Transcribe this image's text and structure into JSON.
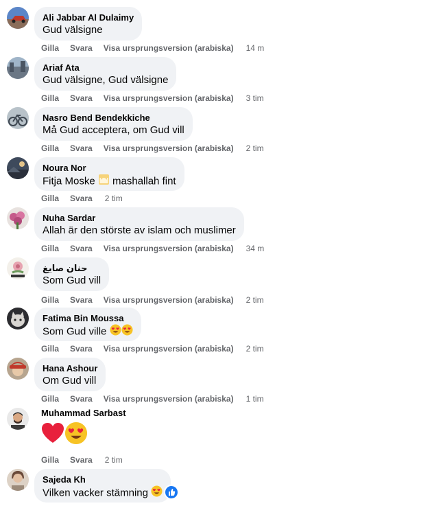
{
  "actions": {
    "like": "Gilla",
    "reply": "Svara",
    "see_original": "Visa ursprungsversion (arabiska)"
  },
  "comments": [
    {
      "author": "Ali Jabbar Al Dulaimy",
      "text": "Gud välsigne",
      "time": "14 m",
      "translated": true,
      "avatar": "red-car-avatar"
    },
    {
      "author": "Ariaf Ata",
      "text": "Gud välsigne, Gud välsigne",
      "time": "3 tim",
      "translated": true,
      "avatar": "city-scene-avatar"
    },
    {
      "author": "Nasro Bend Bendekkiche",
      "text": "Må Gud acceptera, om Gud vill",
      "time": "2 tim",
      "translated": true,
      "avatar": "bicycle-avatar"
    },
    {
      "author": "Noura Nor",
      "text": "Fitja Moske",
      "text_suffix": "mashallah fint",
      "inline_emoji": "mosque-emoji",
      "time": "2 tim",
      "translated": false,
      "avatar": "landscape-avatar"
    },
    {
      "author": "Nuha Sardar",
      "text": "Allah är den störste av islam och muslimer",
      "time": "34 m",
      "translated": true,
      "avatar": "flowers-avatar"
    },
    {
      "author": "حنان صايغ",
      "text": "Som Gud vill",
      "time": "2 tim",
      "translated": true,
      "avatar": "rose-avatar"
    },
    {
      "author": "Fatima Bin Moussa",
      "text": "Som Gud ville",
      "trailing_emojis": [
        "heart-eyes-emoji",
        "heart-eyes-emoji"
      ],
      "time": "2 tim",
      "translated": true,
      "avatar": "cat-avatar"
    },
    {
      "author": "Hana Ashour",
      "text": "Om Gud vill",
      "time": "1 tim",
      "translated": true,
      "avatar": "girl-red-hat-avatar"
    },
    {
      "author": "Muhammad Sarbast",
      "text": "",
      "big_emojis": [
        "red-heart-emoji",
        "heart-eyes-emoji"
      ],
      "time": "2 tim",
      "translated": false,
      "avatar": "man-avatar"
    },
    {
      "author": "Sajeda Kh",
      "text": "Vilken vacker stämning",
      "trailing_emojis": [
        "heart-eyes-emoji"
      ],
      "reaction": "like-reaction-icon",
      "avatar": "woman-avatar"
    }
  ],
  "colors": {
    "bubble": "#f0f2f5",
    "secondary_text": "#65676b",
    "like_blue": "#1877f2"
  }
}
